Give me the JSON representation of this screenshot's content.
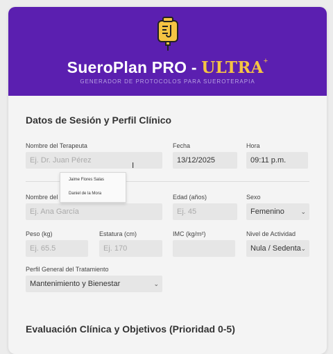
{
  "header": {
    "title_main": "SueroPlan PRO - ",
    "title_accent": "ULTRA",
    "title_sup": "+",
    "subtitle": "GENERADOR DE PROTOCOLOS PARA SUEROTERAPIA",
    "brand_color": "#5b1fb0",
    "accent_color": "#f5c443",
    "logo_icon": "iv-bag-icon"
  },
  "session": {
    "title": "Datos de Sesión y Perfil Clínico",
    "therapist_label": "Nombre del Terapeuta",
    "therapist_placeholder": "Ej. Dr. Juan Pérez",
    "date_label": "Fecha",
    "date_value": "13/12/2025",
    "time_label": "Hora",
    "time_value": "09:11 p.m.",
    "autocomplete": [
      "Jaime Flores Salas",
      "Daniel de la Mora"
    ],
    "patient_label": "Nombre del P",
    "patient_placeholder": "Ej. Ana García",
    "age_label": "Edad (años)",
    "age_placeholder": "Ej. 45",
    "sex_label": "Sexo",
    "sex_value": "Femenino",
    "weight_label": "Peso (kg)",
    "weight_placeholder": "Ej. 65.5",
    "height_label": "Estatura (cm)",
    "height_placeholder": "Ej. 170",
    "bmi_label": "IMC (kg/m²)",
    "bmi_value": "",
    "activity_label": "Nivel de Actividad",
    "activity_value": "Nula / Sedenta",
    "profile_label": "Perfil General del Tratamiento",
    "profile_value": "Mantenimiento y Bienestar"
  },
  "evaluation": {
    "title": "Evaluación Clínica y Objetivos (Prioridad 0-5)"
  }
}
